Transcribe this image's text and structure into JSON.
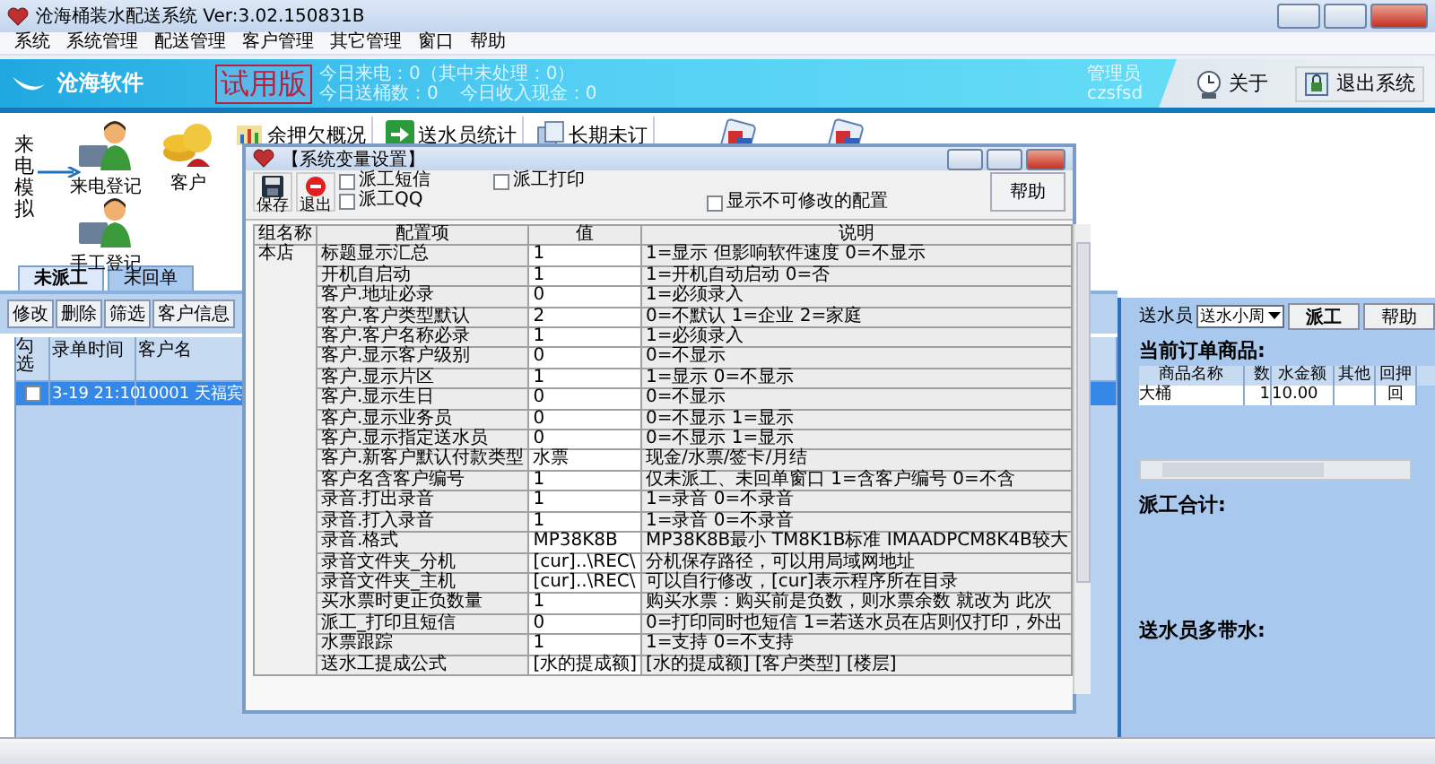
{
  "window": {
    "title": "沧海桶装水配送系统 Ver:3.02.150831B"
  },
  "menu": [
    "系统",
    "系统管理",
    "配送管理",
    "客户管理",
    "其它管理",
    "窗口",
    "帮助"
  ],
  "banner": {
    "logo": "沧海软件",
    "trial": "试用版",
    "stats": [
      "今日来电：0（其中未处理：0）",
      "今日送桶数：0",
      "今日收入现金：0"
    ],
    "user_role": "管理员",
    "user_name": "czsfsd",
    "buttons": [
      "关于",
      "退出系统"
    ]
  },
  "quick": {
    "side_label": "来电模拟",
    "items": [
      "来电登记",
      "客户",
      "手工登记"
    ]
  },
  "toolbar": [
    "余押欠概况",
    "送水员统计",
    "长期未订"
  ],
  "tabs": [
    {
      "label": "未派工",
      "selected": true
    },
    {
      "label": "未回单",
      "selected": false
    }
  ],
  "actions": [
    "修改",
    "删除",
    "筛选",
    "客户信息"
  ],
  "orders": {
    "columns": [
      "勾选",
      "录单时间",
      "客户名"
    ],
    "rows": [
      {
        "checked": false,
        "selected": true,
        "time": "3-19 21:10",
        "customer": "10001 天福宾"
      }
    ]
  },
  "dialog": {
    "title": "【系统变量设置】",
    "tools": [
      "保存",
      "退出"
    ],
    "options": [
      {
        "label": "派工短信",
        "checked": false
      },
      {
        "label": "派工QQ",
        "checked": false
      },
      {
        "label": "派工打印",
        "checked": false
      },
      {
        "label": "显示不可修改的配置",
        "checked": false
      }
    ],
    "help": "帮助",
    "columns": [
      "组名称",
      "配置项",
      "值",
      "说明"
    ],
    "group": "本店",
    "rows": [
      {
        "item": "标题显示汇总",
        "value": "1",
        "note": "1=显示 但影响软件速度 0=不显示"
      },
      {
        "item": "开机自启动",
        "value": "1",
        "note": "1=开机自动启动 0=否"
      },
      {
        "item": "客户.地址必录",
        "value": "0",
        "note": "1=必须录入"
      },
      {
        "item": "客户.客户类型默认",
        "value": "2",
        "note": "0=不默认 1=企业 2=家庭"
      },
      {
        "item": "客户.客户名称必录",
        "value": "1",
        "note": "1=必须录入"
      },
      {
        "item": "客户.显示客户级别",
        "value": "0",
        "note": "0=不显示"
      },
      {
        "item": "客户.显示片区",
        "value": "1",
        "note": "1=显示 0=不显示"
      },
      {
        "item": "客户.显示生日",
        "value": "0",
        "note": "0=不显示"
      },
      {
        "item": "客户.显示业务员",
        "value": "0",
        "note": "0=不显示 1=显示"
      },
      {
        "item": "客户.显示指定送水员",
        "value": "0",
        "note": "0=不显示 1=显示"
      },
      {
        "item": "客户.新客户默认付款类型",
        "value": "水票",
        "note": "现金/水票/签卡/月结"
      },
      {
        "item": "客户名含客户编号",
        "value": "1",
        "note": "仅未派工、未回单窗口 1=含客户编号 0=不含"
      },
      {
        "item": "录音.打出录音",
        "value": "1",
        "note": "1=录音 0=不录音"
      },
      {
        "item": "录音.打入录音",
        "value": "1",
        "note": "1=录音 0=不录音"
      },
      {
        "item": "录音.格式",
        "value": "MP38K8B",
        "note": "MP38K8B最小 TM8K1B标准 IMAADPCM8K4B较大"
      },
      {
        "item": "录音文件夹_分机",
        "value": "[cur]..\\REC\\",
        "note": "分机保存路径，可以用局域网地址"
      },
      {
        "item": "录音文件夹_主机",
        "value": "[cur]..\\REC\\",
        "note": "可以自行修改，[cur]表示程序所在目录"
      },
      {
        "item": "买水票时更正负数量",
        "value": "1",
        "note": "购买水票：购买前是负数，则水票余数 就改为 此次"
      },
      {
        "item": "派工_打印且短信",
        "value": "0",
        "note": "0=打印同时也短信 1=若送水员在店则仅打印，外出"
      },
      {
        "item": "水票跟踪",
        "value": "1",
        "note": "1=支持 0=不支持"
      },
      {
        "item": "送水工提成公式",
        "value": "[水的提成额]",
        "note": "[水的提成额] [客户类型] [楼层]"
      }
    ]
  },
  "dispatch": {
    "label": "送水员",
    "courier": "送水小周",
    "buttons": [
      "派工",
      "帮助"
    ],
    "goods_title": "当前订单商品:",
    "goods_columns": [
      "商品名称",
      "数",
      "水金额",
      "其他",
      "回押"
    ],
    "goods_rows": [
      {
        "name": "大桶",
        "qty": "1",
        "amount": "10.00",
        "deposit": "回"
      }
    ],
    "total_label": "派工合计:",
    "extra_label": "送水员多带水:"
  }
}
